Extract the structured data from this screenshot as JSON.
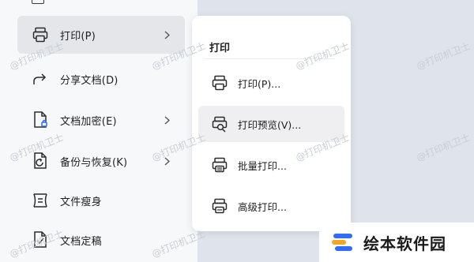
{
  "main_menu": {
    "items": [
      {
        "label": "打印(P)",
        "icon": "printer-icon",
        "has_submenu": true,
        "hovered": true
      },
      {
        "label": "分享文档(D)",
        "icon": "share-icon",
        "has_submenu": false
      },
      {
        "label": "文档加密(E)",
        "icon": "document-lock-icon",
        "has_submenu": true
      },
      {
        "label": "备份与恢复(K)",
        "icon": "backup-restore-icon",
        "has_submenu": true
      },
      {
        "label": "文件瘦身",
        "icon": "file-slim-icon",
        "has_submenu": false
      },
      {
        "label": "文档定稿",
        "icon": "document-finalize-icon",
        "has_submenu": false
      }
    ]
  },
  "print_submenu": {
    "title": "打印",
    "items": [
      {
        "label": "打印(P)...",
        "icon": "printer-icon"
      },
      {
        "label": "打印预览(V)...",
        "icon": "print-preview-icon",
        "hovered": true
      },
      {
        "label": "批量打印...",
        "icon": "batch-print-icon"
      },
      {
        "label": "高级打印...",
        "icon": "advanced-print-icon"
      }
    ]
  },
  "watermark": "@打印机卫士",
  "logo": {
    "text": "绘本软件园",
    "colors": [
      "#2f6df6",
      "#f5a623"
    ]
  }
}
